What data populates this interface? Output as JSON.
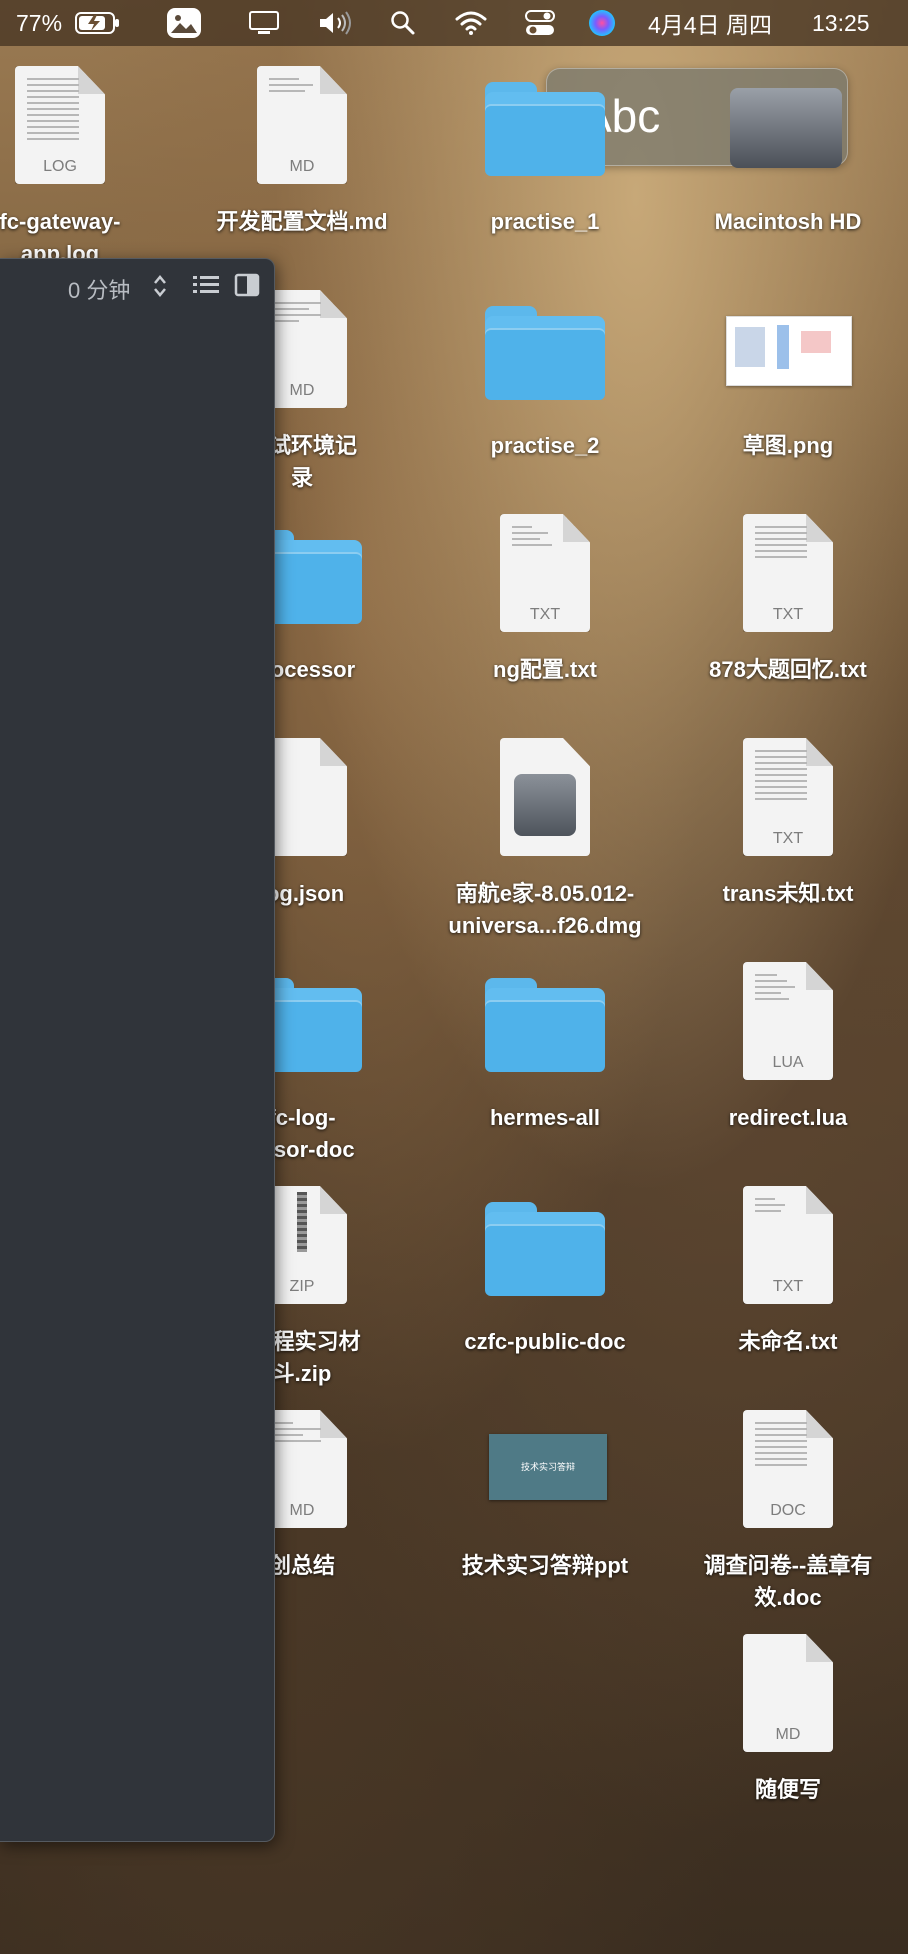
{
  "menubar": {
    "battery": "77%",
    "date": "4月4日 周四",
    "time": "13:25"
  },
  "input_widget": {
    "text": "Abc"
  },
  "finder": {
    "sort_label": "0 分钟"
  },
  "desktop_icons": {
    "c1r1": {
      "label1": "fc-gateway-",
      "label2": "app.log",
      "ext": "LOG"
    },
    "c2r1": {
      "label1": "开发配置文档.md",
      "ext": "MD"
    },
    "c3r1": {
      "label1": "practise_1"
    },
    "c4r1": {
      "label1": "Macintosh HD"
    },
    "c2r2": {
      "label1": "测试环境记",
      "label2": "录",
      "ext": "MD"
    },
    "c3r2": {
      "label1": "practise_2"
    },
    "c4r2": {
      "label1": "草图.png"
    },
    "c2r3": {
      "label1": "processor"
    },
    "c3r3": {
      "label1": "ng配置.txt",
      "ext": "TXT"
    },
    "c4r3": {
      "label1": "878大题回忆.txt",
      "ext": "TXT"
    },
    "c2r4": {
      "label1": "log.json"
    },
    "c3r4": {
      "label1": "南航e家-8.05.012-",
      "label2": "universa...f26.dmg"
    },
    "c4r4": {
      "label1": "trans未知.txt",
      "ext": "TXT"
    },
    "c2r5": {
      "label1": "fc-log-",
      "label2": "essor-doc"
    },
    "c3r5": {
      "label1": "hermes-all"
    },
    "c4r5": {
      "label1": "redirect.lua",
      "ext": "LUA"
    },
    "c2r6": {
      "label1": "-工程实习材",
      "label2": "斗.zip",
      "ext": "ZIP"
    },
    "c3r6": {
      "label1": "czfc-public-doc"
    },
    "c4r6": {
      "label1": "未命名.txt",
      "ext": "TXT"
    },
    "c2r7": {
      "label1": "创总结",
      "ext": "MD"
    },
    "c3r7": {
      "label1": "技术实习答辩ppt",
      "slide_text": "技术实习答辩"
    },
    "c4r7": {
      "label1": "调查问卷--盖章有",
      "label2": "效.doc",
      "ext": "DOC"
    },
    "c4r8": {
      "label1": "随便写",
      "ext": "MD"
    }
  }
}
